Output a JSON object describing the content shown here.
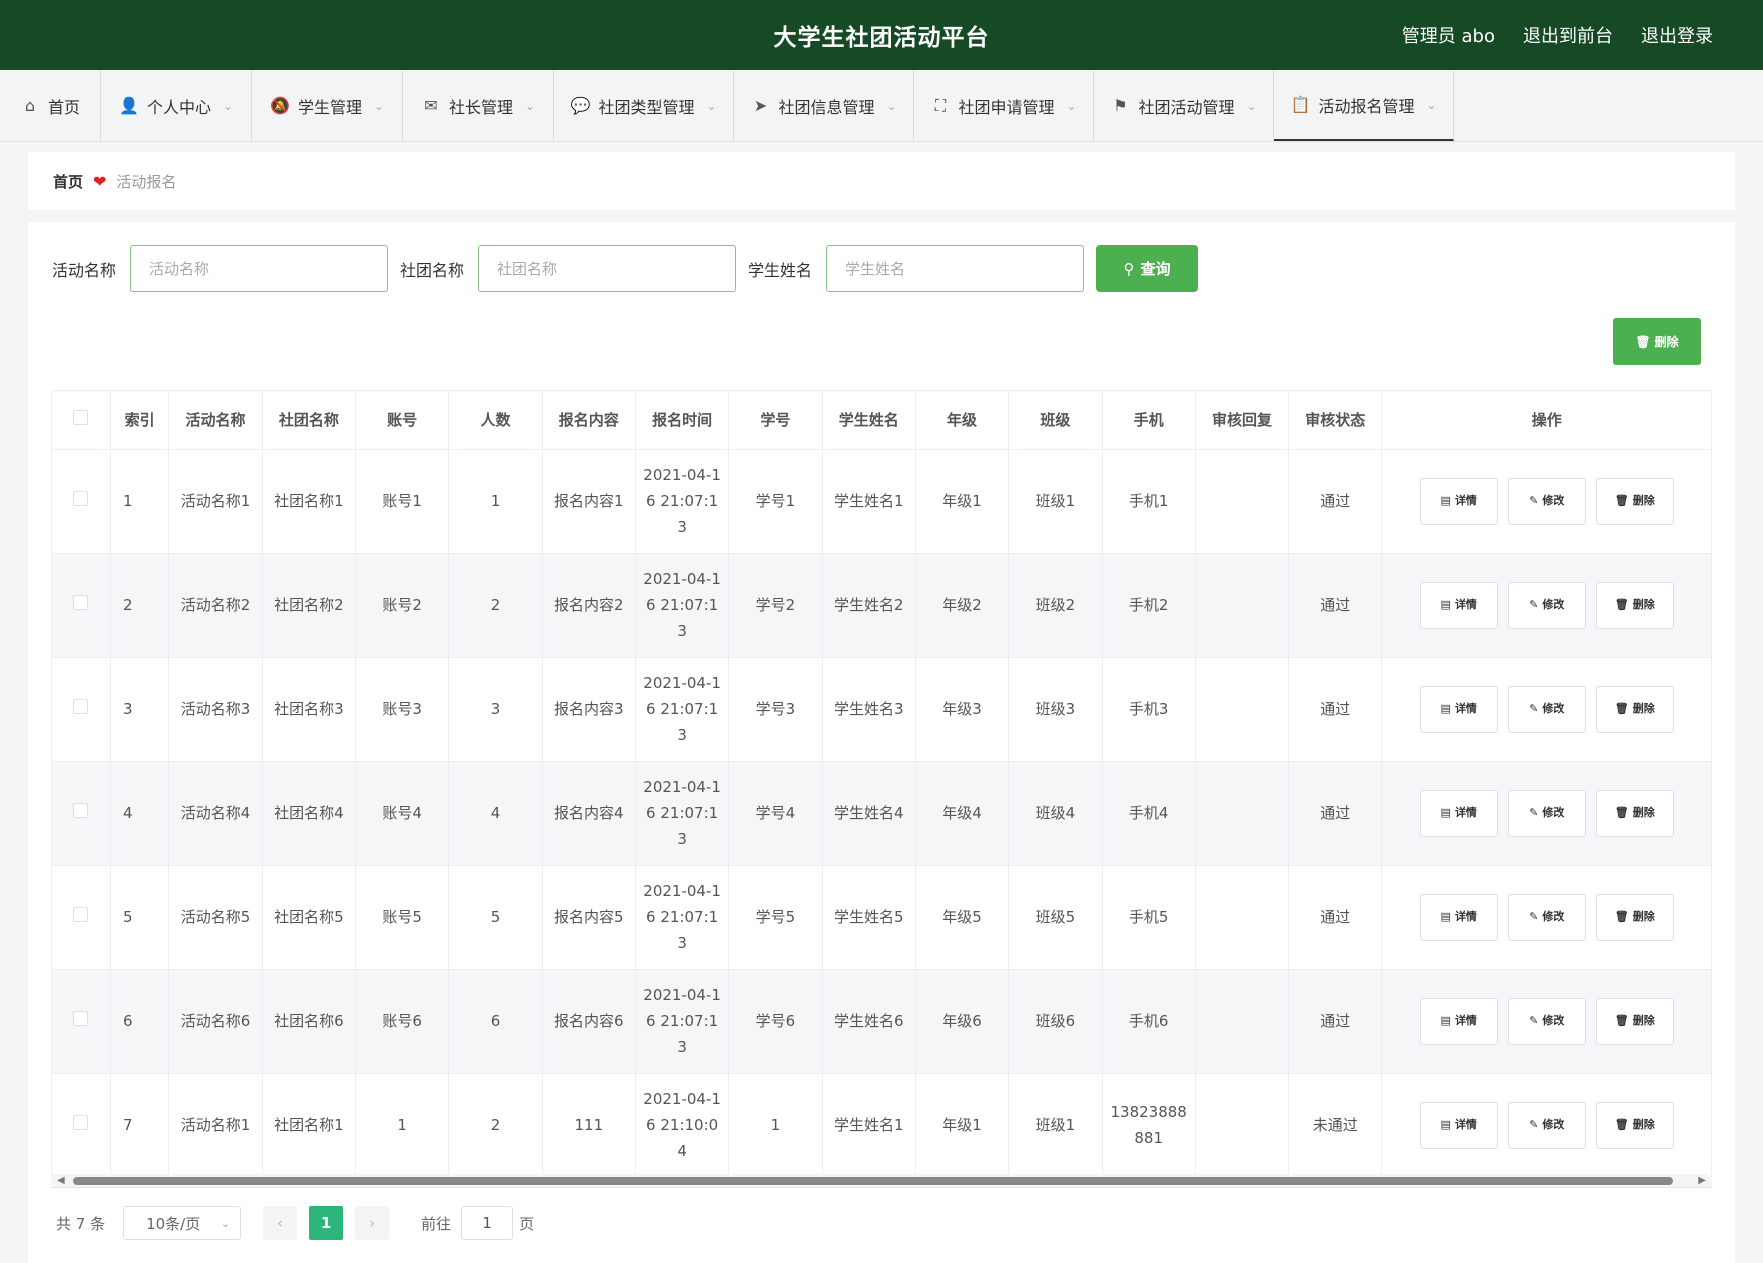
{
  "header": {
    "title": "大学生社团活动平台",
    "admin_label": "管理员 abo",
    "back_front": "退出到前台",
    "logout": "退出登录"
  },
  "nav": [
    {
      "label": "首页",
      "icon": "home-icon",
      "chevron": false
    },
    {
      "label": "个人中心",
      "icon": "user-icon",
      "chevron": true
    },
    {
      "label": "学生管理",
      "icon": "bell-off-icon",
      "chevron": true
    },
    {
      "label": "社长管理",
      "icon": "mail-icon",
      "chevron": true
    },
    {
      "label": "社团类型管理",
      "icon": "chat-icon",
      "chevron": true
    },
    {
      "label": "社团信息管理",
      "icon": "send-icon",
      "chevron": true
    },
    {
      "label": "社团申请管理",
      "icon": "fullscreen-icon",
      "chevron": true
    },
    {
      "label": "社团活动管理",
      "icon": "flag-icon",
      "chevron": true
    },
    {
      "label": "活动报名管理",
      "icon": "clipboard-check-icon",
      "chevron": true
    }
  ],
  "breadcrumb": {
    "home": "首页",
    "current": "活动报名"
  },
  "search": {
    "fields": [
      {
        "label": "活动名称",
        "placeholder": "活动名称"
      },
      {
        "label": "社团名称",
        "placeholder": "社团名称"
      },
      {
        "label": "学生姓名",
        "placeholder": "学生姓名"
      }
    ],
    "query_label": "查询"
  },
  "toolbar": {
    "delete_label": "删除"
  },
  "table": {
    "columns": [
      "",
      "索引",
      "活动名称",
      "社团名称",
      "账号",
      "人数",
      "报名内容",
      "报名时间",
      "学号",
      "学生姓名",
      "年级",
      "班级",
      "手机",
      "审核回复",
      "审核状态",
      "操作"
    ],
    "rows": [
      {
        "index": "1",
        "activity": "活动名称1",
        "club": "社团名称1",
        "account": "账号1",
        "count": "1",
        "content": "报名内容1",
        "time": "2021-04-16 21:07:13",
        "student_no": "学号1",
        "student_name": "学生姓名1",
        "grade": "年级1",
        "class": "班级1",
        "phone": "手机1",
        "reply": "",
        "status": "通过"
      },
      {
        "index": "2",
        "activity": "活动名称2",
        "club": "社团名称2",
        "account": "账号2",
        "count": "2",
        "content": "报名内容2",
        "time": "2021-04-16 21:07:13",
        "student_no": "学号2",
        "student_name": "学生姓名2",
        "grade": "年级2",
        "class": "班级2",
        "phone": "手机2",
        "reply": "",
        "status": "通过"
      },
      {
        "index": "3",
        "activity": "活动名称3",
        "club": "社团名称3",
        "account": "账号3",
        "count": "3",
        "content": "报名内容3",
        "time": "2021-04-16 21:07:13",
        "student_no": "学号3",
        "student_name": "学生姓名3",
        "grade": "年级3",
        "class": "班级3",
        "phone": "手机3",
        "reply": "",
        "status": "通过"
      },
      {
        "index": "4",
        "activity": "活动名称4",
        "club": "社团名称4",
        "account": "账号4",
        "count": "4",
        "content": "报名内容4",
        "time": "2021-04-16 21:07:13",
        "student_no": "学号4",
        "student_name": "学生姓名4",
        "grade": "年级4",
        "class": "班级4",
        "phone": "手机4",
        "reply": "",
        "status": "通过"
      },
      {
        "index": "5",
        "activity": "活动名称5",
        "club": "社团名称5",
        "account": "账号5",
        "count": "5",
        "content": "报名内容5",
        "time": "2021-04-16 21:07:13",
        "student_no": "学号5",
        "student_name": "学生姓名5",
        "grade": "年级5",
        "class": "班级5",
        "phone": "手机5",
        "reply": "",
        "status": "通过"
      },
      {
        "index": "6",
        "activity": "活动名称6",
        "club": "社团名称6",
        "account": "账号6",
        "count": "6",
        "content": "报名内容6",
        "time": "2021-04-16 21:07:13",
        "student_no": "学号6",
        "student_name": "学生姓名6",
        "grade": "年级6",
        "class": "班级6",
        "phone": "手机6",
        "reply": "",
        "status": "通过"
      },
      {
        "index": "7",
        "activity": "活动名称1",
        "club": "社团名称1",
        "account": "1",
        "count": "2",
        "content": "111",
        "time": "2021-04-16 21:10:04",
        "student_no": "1",
        "student_name": "学生姓名1",
        "grade": "年级1",
        "class": "班级1",
        "phone": "13823888881",
        "reply": "",
        "status": "未通过"
      }
    ],
    "row_actions": {
      "detail": "详情",
      "edit": "修改",
      "delete": "删除"
    }
  },
  "pagination": {
    "total_text": "共 7 条",
    "page_size": "10条/页",
    "current_page": "1",
    "goto_label": "前往",
    "goto_value": "1",
    "page_suffix": "页"
  },
  "colors": {
    "header_bg": "#164a25",
    "accent": "#4caf50",
    "page_active": "#2db67c"
  }
}
